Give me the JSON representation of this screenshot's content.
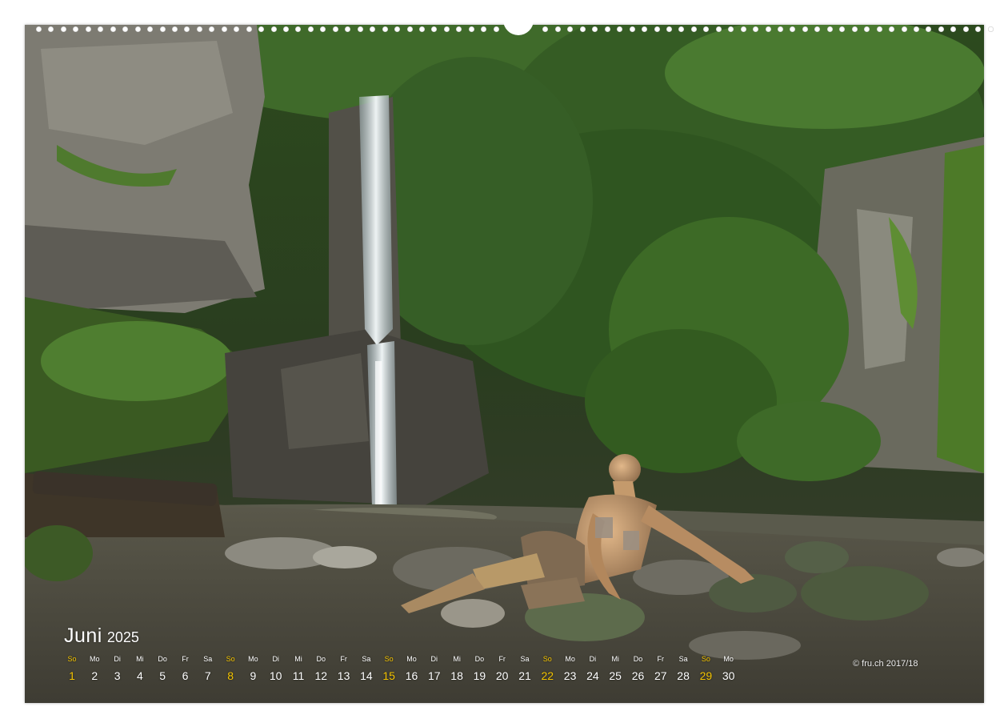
{
  "calendar": {
    "month": "Juni",
    "year": "2025",
    "sunday_color": "#f4c400",
    "text_color": "#ffffff",
    "days": [
      {
        "wd": "So",
        "d": "1",
        "sunday": true
      },
      {
        "wd": "Mo",
        "d": "2",
        "sunday": false
      },
      {
        "wd": "Di",
        "d": "3",
        "sunday": false
      },
      {
        "wd": "Mi",
        "d": "4",
        "sunday": false
      },
      {
        "wd": "Do",
        "d": "5",
        "sunday": false
      },
      {
        "wd": "Fr",
        "d": "6",
        "sunday": false
      },
      {
        "wd": "Sa",
        "d": "7",
        "sunday": false
      },
      {
        "wd": "So",
        "d": "8",
        "sunday": true
      },
      {
        "wd": "Mo",
        "d": "9",
        "sunday": false
      },
      {
        "wd": "Di",
        "d": "10",
        "sunday": false
      },
      {
        "wd": "Mi",
        "d": "11",
        "sunday": false
      },
      {
        "wd": "Do",
        "d": "12",
        "sunday": false
      },
      {
        "wd": "Fr",
        "d": "13",
        "sunday": false
      },
      {
        "wd": "Sa",
        "d": "14",
        "sunday": false
      },
      {
        "wd": "So",
        "d": "15",
        "sunday": true
      },
      {
        "wd": "Mo",
        "d": "16",
        "sunday": false
      },
      {
        "wd": "Di",
        "d": "17",
        "sunday": false
      },
      {
        "wd": "Mi",
        "d": "18",
        "sunday": false
      },
      {
        "wd": "Do",
        "d": "19",
        "sunday": false
      },
      {
        "wd": "Fr",
        "d": "20",
        "sunday": false
      },
      {
        "wd": "Sa",
        "d": "21",
        "sunday": false
      },
      {
        "wd": "So",
        "d": "22",
        "sunday": true
      },
      {
        "wd": "Mo",
        "d": "23",
        "sunday": false
      },
      {
        "wd": "Di",
        "d": "24",
        "sunday": false
      },
      {
        "wd": "Mi",
        "d": "25",
        "sunday": false
      },
      {
        "wd": "Do",
        "d": "26",
        "sunday": false
      },
      {
        "wd": "Fr",
        "d": "27",
        "sunday": false
      },
      {
        "wd": "Sa",
        "d": "28",
        "sunday": false
      },
      {
        "wd": "So",
        "d": "29",
        "sunday": true
      },
      {
        "wd": "Mo",
        "d": "30",
        "sunday": false
      }
    ]
  },
  "copyright": "© fru.ch 2017/18",
  "photo": {
    "subject": "body-painted-figure-at-forest-waterfall",
    "palette": {
      "foliage_dark": "#1f2f17",
      "foliage": "#3f6a2a",
      "foliage_light": "#6f9e3f",
      "rock": "#7a7a70",
      "rock_dark": "#3a3a36",
      "water": "#cfd9dc",
      "pool": "#5a5a4c",
      "skin": "#c89a70"
    }
  }
}
